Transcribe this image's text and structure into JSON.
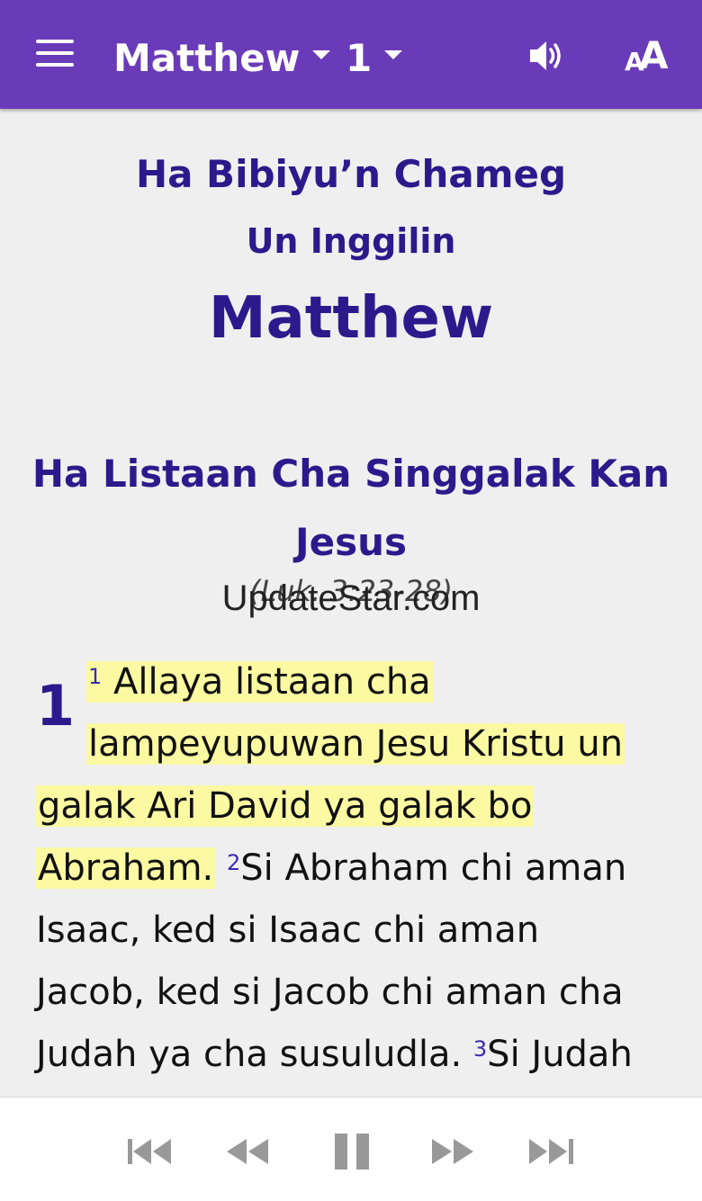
{
  "topbar": {
    "book": "Matthew",
    "chapter": "1",
    "icons": {
      "menu": "hamburger-menu-icon",
      "audio": "speaker-icon",
      "font": "font-size-icon"
    },
    "colors": {
      "bar": "#6a3bb8",
      "text": "#ffffff"
    }
  },
  "heading": {
    "intro_line1": "Ha Bibiyu’n Chameg",
    "intro_line2": "Un Inggilin",
    "book_title": "Matthew"
  },
  "section": {
    "title_line1": "Ha Listaan Cha Singgalak Kan",
    "title_line2": "Jesus",
    "reference": "(Luk. 3:23-28)",
    "watermark": "UpdateStar.com"
  },
  "chapter_number": "1",
  "verses": {
    "v1_num": "1",
    "v1_part1": "Allaya listaan cha",
    "v1_part2": "lampeyupuwan Jesu Kristu un",
    "v1_part3": "galak Ari David ya galak bo",
    "v1_part4": "Abraham.",
    "v2_num": "2",
    "v2_part1": "Si Abraham chi aman",
    "v2_part2": "Isaac, ked si Isaac chi aman",
    "v2_part3": "Jacob, ked si Jacob chi aman cha",
    "v2_part4": "Judah ya cha susuludla.",
    "v3_num": "3",
    "v3_part1": "Si Judah"
  },
  "highlight_color": "#fbf9a2",
  "player": {
    "icons": [
      "skip-to-start-icon",
      "rewind-icon",
      "pause-icon",
      "fast-forward-icon",
      "skip-to-end-icon"
    ]
  }
}
